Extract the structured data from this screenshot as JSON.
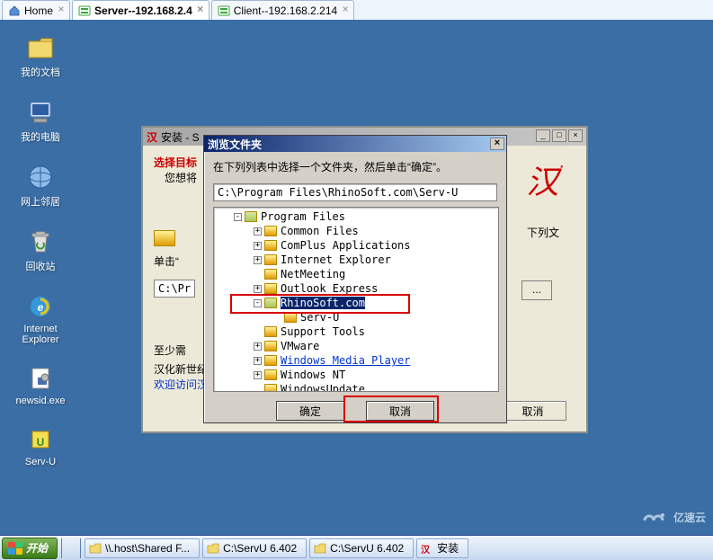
{
  "tabs": [
    {
      "label": "Home",
      "active": false
    },
    {
      "label": "Server--192.168.2.4",
      "active": true
    },
    {
      "label": "Client--192.168.2.214",
      "active": false
    }
  ],
  "desktop": [
    {
      "name": "my-documents",
      "label": "我的文档"
    },
    {
      "name": "my-computer",
      "label": "我的电脑"
    },
    {
      "name": "network-neighborhood",
      "label": "网上邻居"
    },
    {
      "name": "recycle-bin",
      "label": "回收站"
    },
    {
      "name": "internet-explorer",
      "label": "Internet\nExplorer"
    },
    {
      "name": "newsid",
      "label": "newsid.exe"
    },
    {
      "name": "serv-u",
      "label": "Serv-U"
    }
  ],
  "install_wizard": {
    "title_prefix": "安装 - S",
    "select_target_label": "选择目标",
    "you_want_label": "您想将",
    "click_hint": "单击“",
    "short_path": "C:\\Pr",
    "side_text": "下列文",
    "browse_ellipsis": "...",
    "min_space_label": "至少需",
    "footer1": "汉化新世纪",
    "footer2": "欢迎访问汉化",
    "cancel_label": "取消"
  },
  "browse_dialog": {
    "title": "浏览文件夹",
    "hint": "在下列列表中选择一个文件夹，然后单击“确定”。",
    "path": "C:\\Program Files\\RhinoSoft.com\\Serv-U",
    "ok_label": "确定",
    "cancel_label": "取消",
    "tree": [
      {
        "indent": 0,
        "toggle": "-",
        "open": true,
        "label": "Program Files"
      },
      {
        "indent": 1,
        "toggle": "+",
        "label": "Common Files"
      },
      {
        "indent": 1,
        "toggle": "+",
        "label": "ComPlus Applications"
      },
      {
        "indent": 1,
        "toggle": "+",
        "label": "Internet Explorer"
      },
      {
        "indent": 1,
        "toggle": "",
        "label": "NetMeeting"
      },
      {
        "indent": 1,
        "toggle": "+",
        "label": "Outlook Express"
      },
      {
        "indent": 1,
        "toggle": "-",
        "open": true,
        "label": "RhinoSoft.com",
        "selected": true
      },
      {
        "indent": 2,
        "toggle": "",
        "label": "Serv-U"
      },
      {
        "indent": 1,
        "toggle": "",
        "label": "Support Tools"
      },
      {
        "indent": 1,
        "toggle": "+",
        "label": "VMware"
      },
      {
        "indent": 1,
        "toggle": "+",
        "label": "Windows Media Player",
        "link": true
      },
      {
        "indent": 1,
        "toggle": "+",
        "label": "Windows NT"
      },
      {
        "indent": 1,
        "toggle": "",
        "label": "WindowsUpdate"
      }
    ]
  },
  "taskbar": {
    "start_label": "开始",
    "items": [
      {
        "label": "\\\\.host\\Shared F..."
      },
      {
        "label": "C:\\ServU 6.402"
      },
      {
        "label": "C:\\ServU 6.402"
      },
      {
        "label": "安装"
      }
    ]
  },
  "watermark": "亿速云",
  "colors": {
    "desktop_bg": "#3a6ea5",
    "highlight_red": "#d90000",
    "selection": "#0a246a",
    "link": "#0033cc"
  }
}
